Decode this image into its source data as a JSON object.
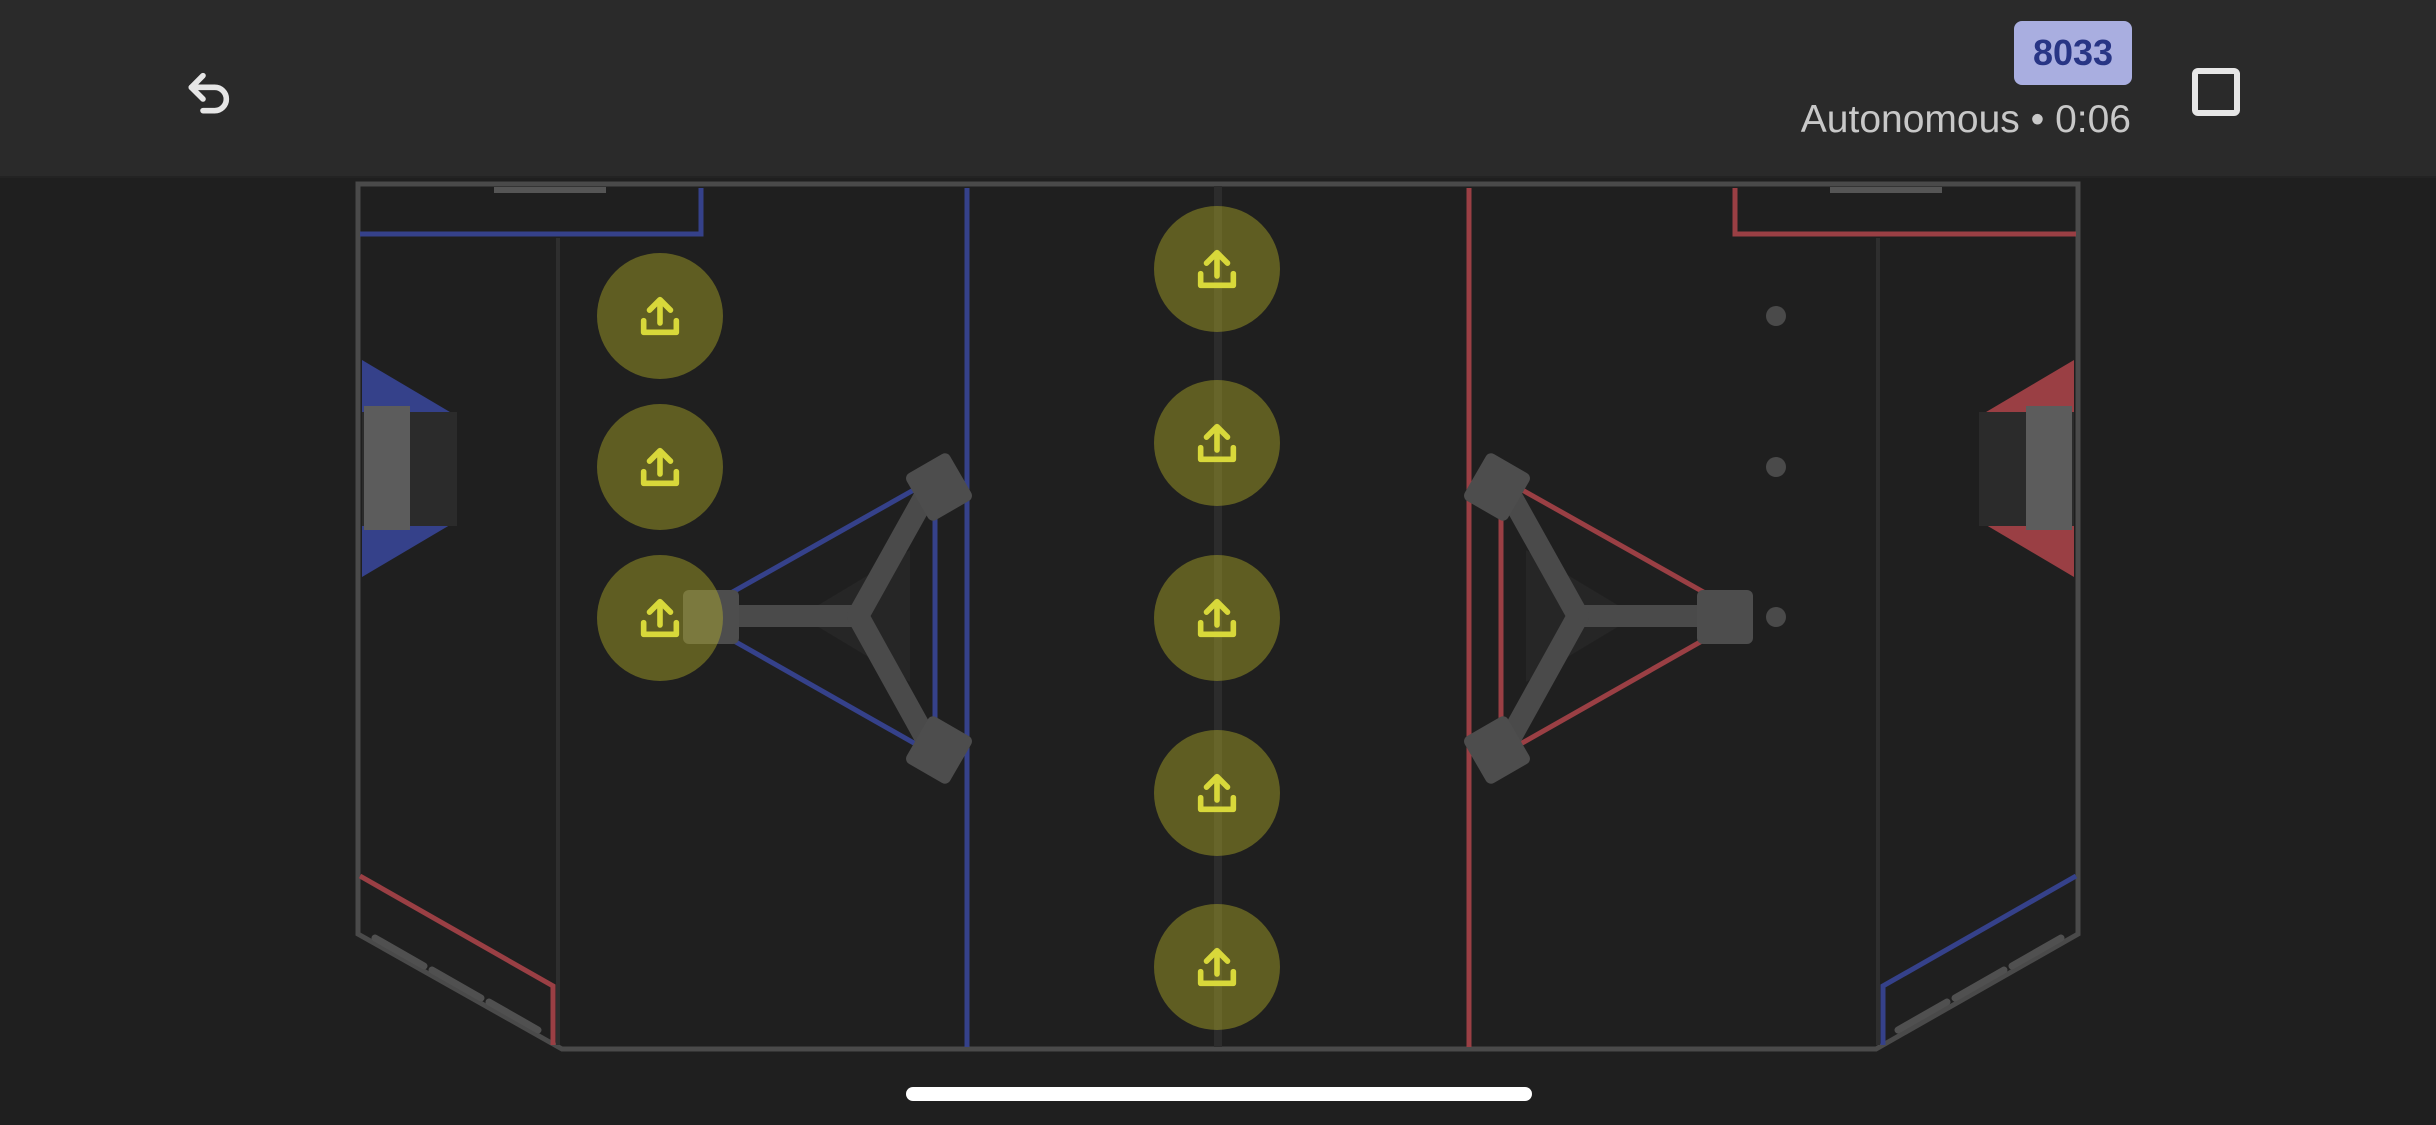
{
  "header": {
    "team_number": "8033",
    "mode_time": "Autonomous • 0:06",
    "icons": {
      "back": "undo-arrow-icon",
      "stop": "stop-square-icon",
      "note": "upload-tray-icon"
    }
  },
  "field": {
    "alliance_colors": {
      "blue": "#35418a",
      "red": "#9a3f44"
    },
    "note_color": "#d8d83a",
    "note_count": 8
  }
}
